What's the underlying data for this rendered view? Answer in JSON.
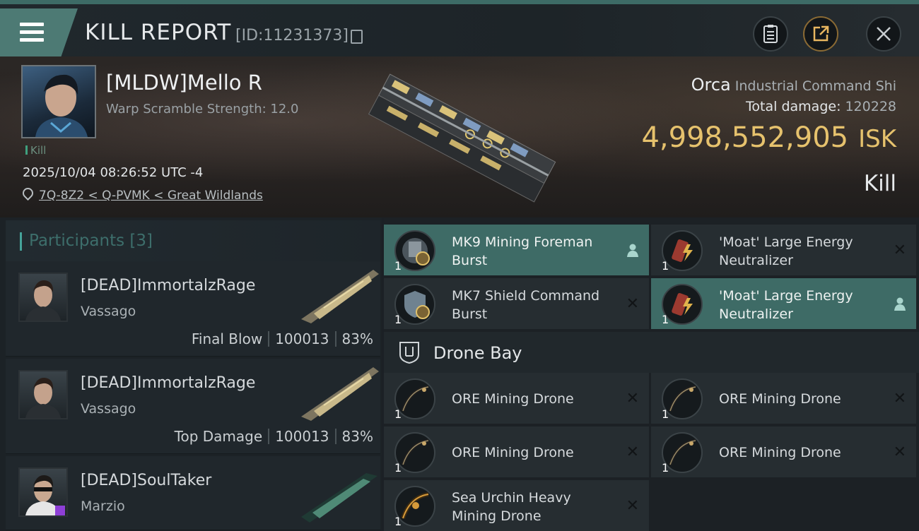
{
  "header": {
    "title": "KILL REPORT",
    "report_id": "[ID:11231373]",
    "icons": [
      "menu-icon",
      "copy-icon",
      "notes-icon",
      "share-icon",
      "close-icon"
    ]
  },
  "victim": {
    "name": "[MLDW]Mello R",
    "warp_scramble": "Warp Scramble Strength: 12.0",
    "tag": "Kill",
    "datetime": "2025/10/04 08:26:52 UTC -4",
    "location": "7Q-8Z2 < Q-PVMK < Great Wildlands"
  },
  "ship": {
    "name": "Orca",
    "class": "Industrial Command Shi",
    "total_damage_label": "Total damage:",
    "total_damage": "120228",
    "isk_value": "4,998,552,905",
    "isk_unit": "ISK",
    "result": "Kill"
  },
  "participants": {
    "header": "Participants",
    "count": "[3]",
    "rows": [
      {
        "name": "[DEAD]ImmortalzRage",
        "ship": "Vassago",
        "role": "Final Blow",
        "damage": "100013",
        "percent": "83%"
      },
      {
        "name": "[DEAD]ImmortalzRage",
        "ship": "Vassago",
        "role": "Top Damage",
        "damage": "100013",
        "percent": "83%"
      },
      {
        "name": "[DEAD]SoulTaker",
        "ship": "Marzio",
        "role": "",
        "damage": "",
        "percent": ""
      }
    ]
  },
  "modules": [
    {
      "name": "MK9 Mining Foreman Burst",
      "qty": "1",
      "active": true,
      "status_icon": "person-icon"
    },
    {
      "name": "'Moat' Large Energy Neutralizer",
      "qty": "1",
      "active": false,
      "status_icon": "close-icon"
    },
    {
      "name": "MK7 Shield Command Burst",
      "qty": "1",
      "active": false,
      "status_icon": "close-icon"
    },
    {
      "name": "'Moat' Large Energy Neutralizer",
      "qty": "1",
      "active": true,
      "status_icon": "person-icon"
    }
  ],
  "drone_bay": {
    "title": "Drone Bay",
    "items": [
      {
        "name": "ORE Mining Drone",
        "qty": "1"
      },
      {
        "name": "ORE Mining Drone",
        "qty": "1"
      },
      {
        "name": "ORE Mining Drone",
        "qty": "1"
      },
      {
        "name": "ORE Mining Drone",
        "qty": "1"
      },
      {
        "name": "Sea Urchin Heavy Mining Drone",
        "qty": "1"
      }
    ]
  },
  "colors": {
    "accent": "#3e6b66",
    "isk": "#e6c26d",
    "background": "#1b2025"
  }
}
